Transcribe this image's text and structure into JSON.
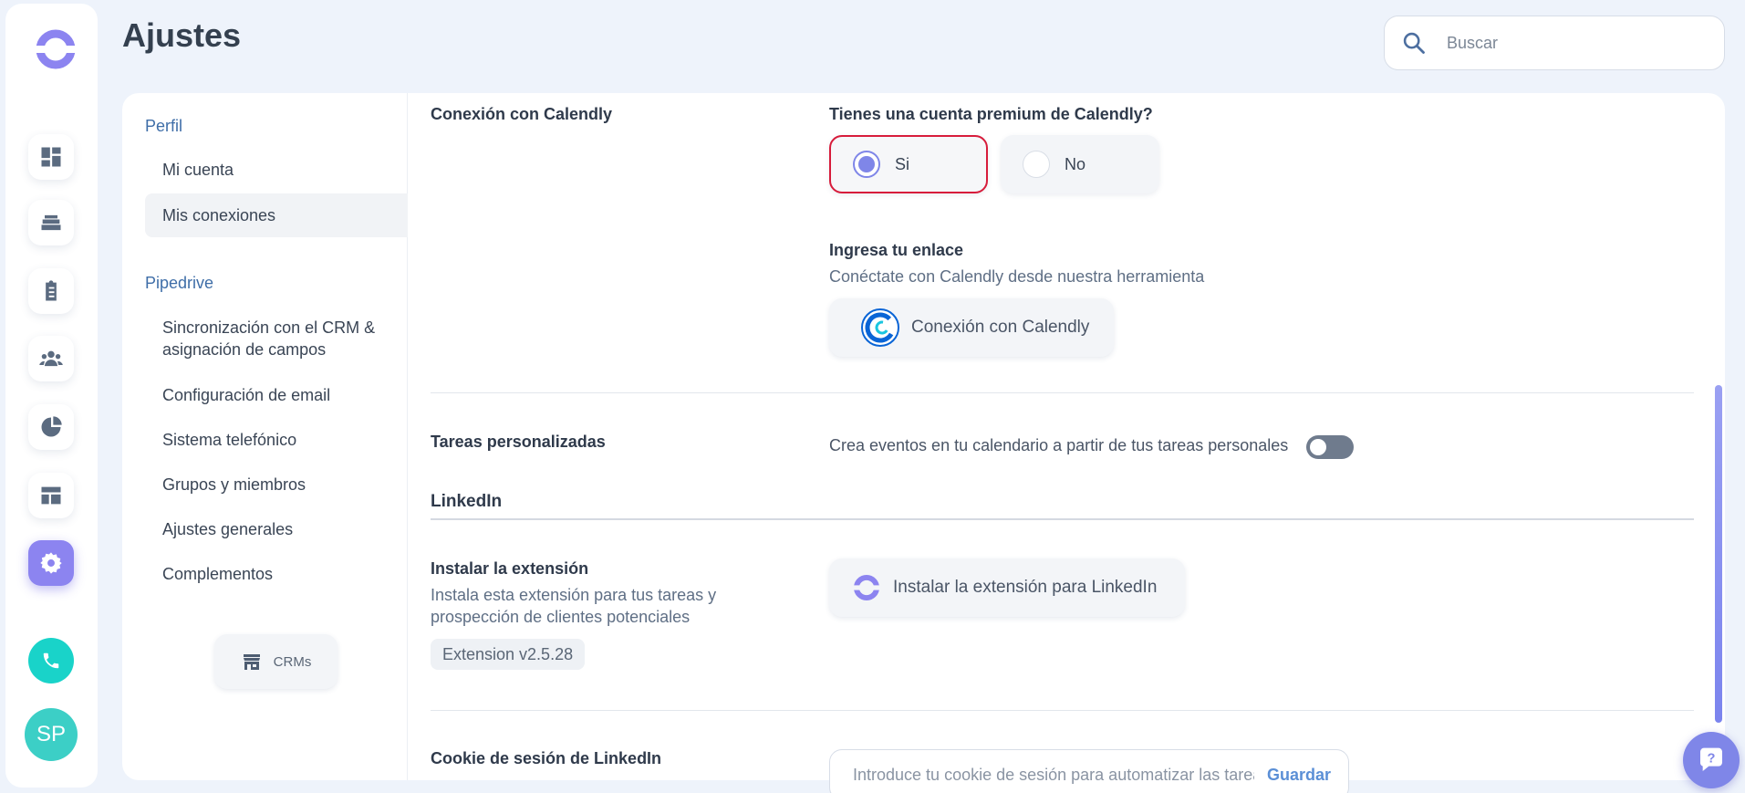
{
  "page": {
    "title": "Ajustes"
  },
  "search": {
    "placeholder": "Buscar"
  },
  "rail": {
    "icons": [
      "dashboard-icon",
      "inbox-icon",
      "tasks-icon",
      "contacts-icon",
      "reports-icon",
      "templates-icon",
      "settings-icon"
    ],
    "avatar_initials": "SP"
  },
  "subnav": {
    "sections": [
      {
        "title": "Perfil",
        "items": [
          "Mi cuenta",
          "Mis conexiones"
        ]
      },
      {
        "title": "Pipedrive",
        "items": [
          "Sincronización con el CRM & asignación de campos",
          "Configuración de email",
          "Sistema telefónico",
          "Grupos y miembros",
          "Ajustes generales",
          "Complementos"
        ]
      }
    ],
    "active_item": "Mis conexiones",
    "crm_button": "CRMs"
  },
  "calendly": {
    "label": "Conexión con Calendly",
    "question": "Tienes una cuenta premium de Calendly?",
    "options": [
      "Si",
      "No"
    ],
    "selected": "Si",
    "link_title": "Ingresa tu enlace",
    "link_desc": "Conéctate con Calendly desde nuestra herramienta",
    "button": "Conexión con Calendly"
  },
  "tasks": {
    "label": "Tareas personalizadas",
    "desc": "Crea eventos en tu calendario a partir de tus tareas personales",
    "enabled": false
  },
  "linkedin": {
    "heading": "LinkedIn",
    "install_label": "Instalar la extensión",
    "install_desc": "Instala esta extensión para tus tareas y prospección de clientes potenciales",
    "version": "Extension v2.5.28",
    "install_button": "Instalar la extensión para LinkedIn",
    "cookie_label": "Cookie de sesión de LinkedIn",
    "cookie_placeholder": "Introduce tu cookie de sesión para automatizar las tareas",
    "cookie_save": "Guardar"
  },
  "colors": {
    "accent": "#7f86e8",
    "selected_border": "#d71c3b",
    "teal": "#19d3c9"
  }
}
